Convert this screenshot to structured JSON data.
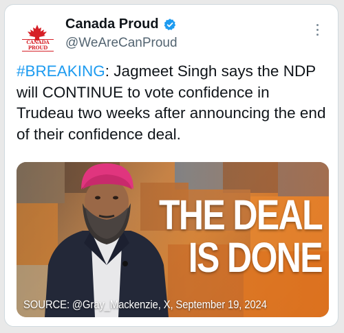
{
  "account": {
    "display_name": "Canada Proud",
    "handle": "@WeAreCanProud",
    "avatar_text": "CANADA PROUD"
  },
  "tweet": {
    "hashtag": "#BREAKING",
    "text": ": Jagmeet Singh says the NDP will CONTINUE to vote confidence in Trudeau two weeks after announcing the end of their confidence deal."
  },
  "media": {
    "headline_line1": "THE DEAL",
    "headline_line2": "IS DONE",
    "source": "SOURCE: @Gray_Mackenzie, X, September 19, 2024"
  },
  "colors": {
    "hashtag": "#1d9bf0",
    "verified": "#1d9bf0",
    "brand_red": "#d61f26"
  },
  "icons": [
    "maple-leaf-icon",
    "verified-badge-icon",
    "more-options-icon"
  ]
}
